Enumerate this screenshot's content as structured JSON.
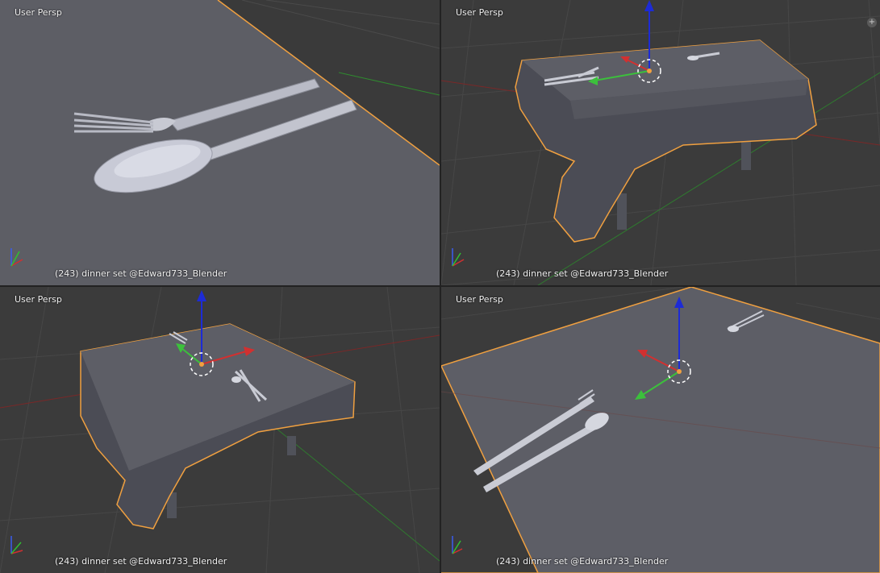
{
  "viewports": [
    {
      "label": "User Persp",
      "status": "(243) dinner set @Edward733_Blender"
    },
    {
      "label": "User Persp",
      "status": "(243) dinner set @Edward733_Blender"
    },
    {
      "label": "User Persp",
      "status": "(243) dinner set @Edward733_Blender"
    },
    {
      "label": "User Persp",
      "status": "(243) dinner set @Edward733_Blender"
    }
  ],
  "colors": {
    "selection_outline": "#f0a040",
    "axis_x": "#d23030",
    "axis_y": "#3cc03c",
    "axis_z": "#2030d0",
    "cloth": "#5e5f66",
    "grid": "#464646",
    "background": "#3b3b3b"
  }
}
